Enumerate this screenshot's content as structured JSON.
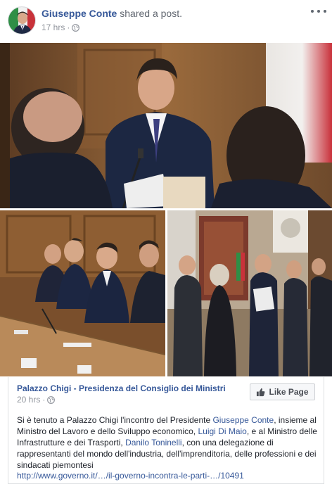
{
  "post": {
    "author_name": "Giuseppe Conte",
    "action_text": "shared a post.",
    "timestamp": "17 hrs",
    "separator": "·",
    "privacy_icon": "globe-icon",
    "more_icon": "more-options-icon"
  },
  "photos": {
    "main_icon": "photo-meeting-main",
    "bottom_left_icon": "photo-meeting-table",
    "bottom_right_icon": "photo-meeting-standing"
  },
  "shared_post": {
    "page_name": "Palazzo Chigi - Presidenza del Consiglio dei Ministri",
    "timestamp": "20 hrs",
    "separator": "·",
    "like_page_label": "Like Page",
    "text_part1": "Si è tenuto a Palazzo Chigi l'incontro del Presidente ",
    "mention1": "Giuseppe Conte",
    "text_part2": ", insieme al Ministro del Lavoro e dello Sviluppo economico, ",
    "mention2": "Luigi Di Maio",
    "text_part3": ", e al Ministro delle Infrastrutture e dei Trasporti, ",
    "mention3": "Danilo Toninelli",
    "text_part4": ", con una delegazione di rappresentanti del mondo dell'industria, dell'imprenditoria, delle professioni e dei sindacati piemontesi",
    "link": "http://www.governo.it/…/il-governo-incontra-le-parti-…/10491"
  },
  "colors": {
    "link_blue": "#365899",
    "meta_gray": "#90949c",
    "text_dark": "#1d2129"
  }
}
